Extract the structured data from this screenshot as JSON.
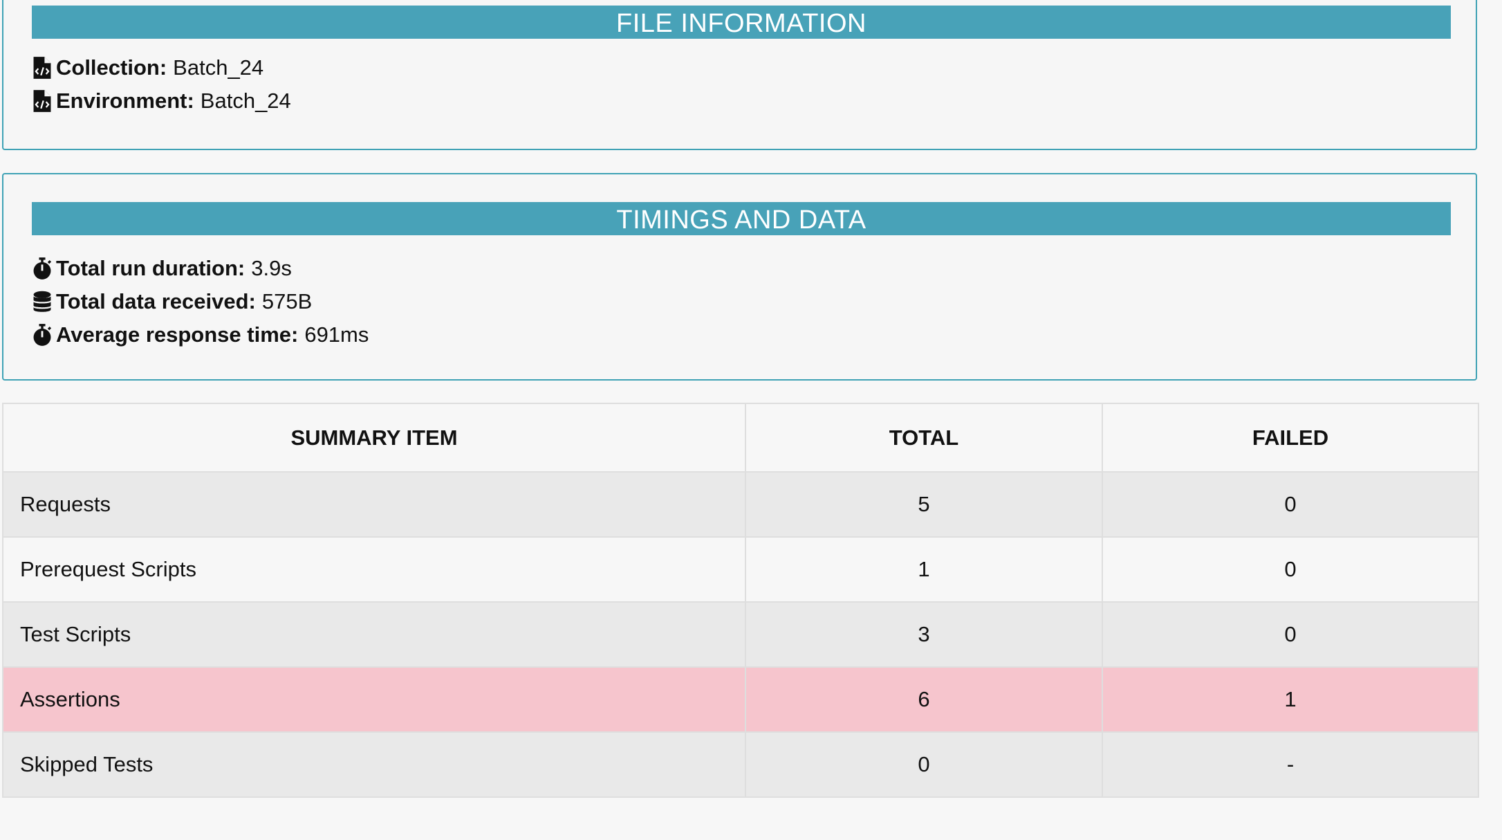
{
  "file_info": {
    "title": "FILE INFORMATION",
    "collection_label": "Collection:",
    "collection_value": "Batch_24",
    "environment_label": "Environment:",
    "environment_value": "Batch_24",
    "icon": "file-code-icon"
  },
  "timings": {
    "title": "TIMINGS AND DATA",
    "duration_label": "Total run duration:",
    "duration_value": "3.9s",
    "data_label": "Total data received:",
    "data_value": "575B",
    "avg_label": "Average response time:",
    "avg_value": "691ms",
    "icons": [
      "stopwatch-icon",
      "database-icon",
      "stopwatch-icon"
    ]
  },
  "summary": {
    "headers": [
      "SUMMARY ITEM",
      "TOTAL",
      "FAILED"
    ],
    "rows": [
      {
        "item": "Requests",
        "total": "5",
        "failed": "0"
      },
      {
        "item": "Prerequest Scripts",
        "total": "1",
        "failed": "0"
      },
      {
        "item": "Test Scripts",
        "total": "3",
        "failed": "0"
      },
      {
        "item": "Assertions",
        "total": "6",
        "failed": "1"
      },
      {
        "item": "Skipped Tests",
        "total": "0",
        "failed": "-"
      }
    ]
  },
  "colors": {
    "banner": "#48a2b8",
    "card_border": "#3fa2b5",
    "failed_row": "#f6c5cd"
  }
}
